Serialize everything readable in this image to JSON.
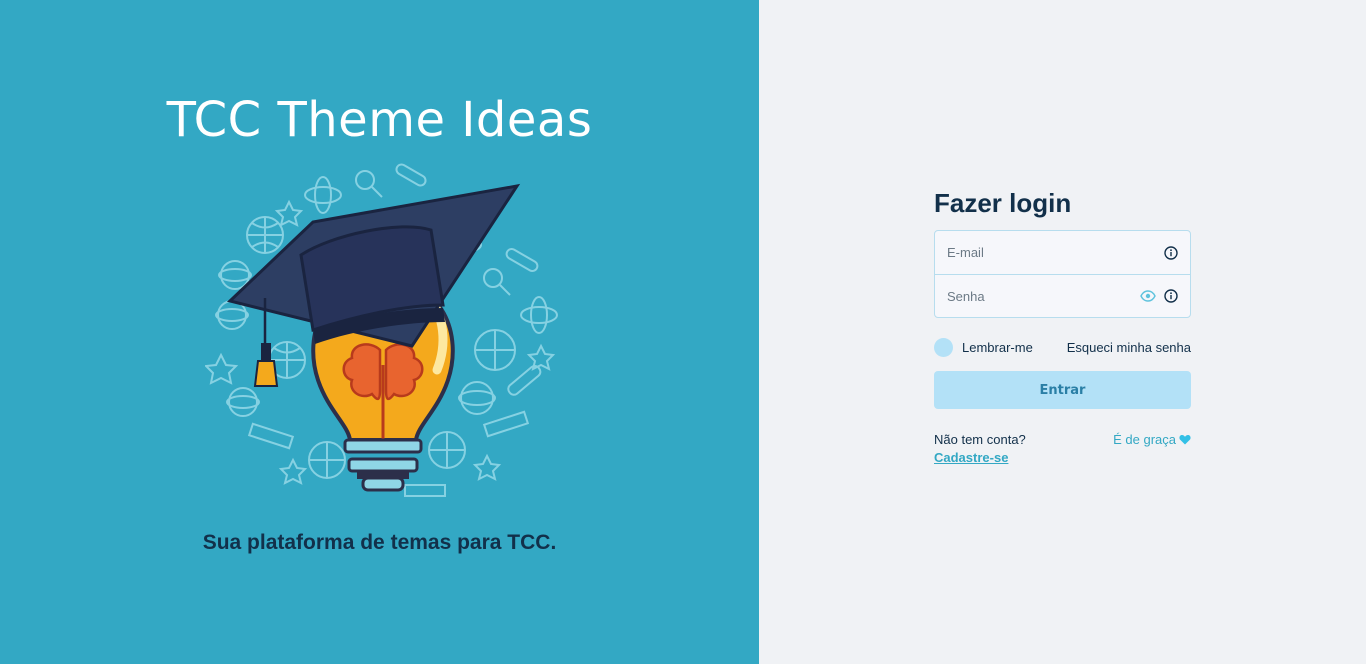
{
  "hero": {
    "title": "TCC Theme Ideas",
    "tagline": "Sua plataforma de temas para TCC.",
    "illustration_icon": "lightbulb-graduation-cap-brain"
  },
  "login": {
    "title": "Fazer login",
    "email": {
      "placeholder": "E-mail",
      "value": ""
    },
    "password": {
      "placeholder": "Senha",
      "value": ""
    },
    "remember_label": "Lembrar-me",
    "forgot_label": "Esqueci minha senha",
    "submit_label": "Entrar",
    "no_account_label": "Não tem conta?",
    "signup_label": "Cadastre-se",
    "free_label": "É de graça"
  },
  "colors": {
    "hero_bg": "#33a8c4",
    "page_bg": "#f0f2f5",
    "heading": "#12304a",
    "accent": "#33a8c4",
    "button_bg": "#b3e1f7"
  }
}
